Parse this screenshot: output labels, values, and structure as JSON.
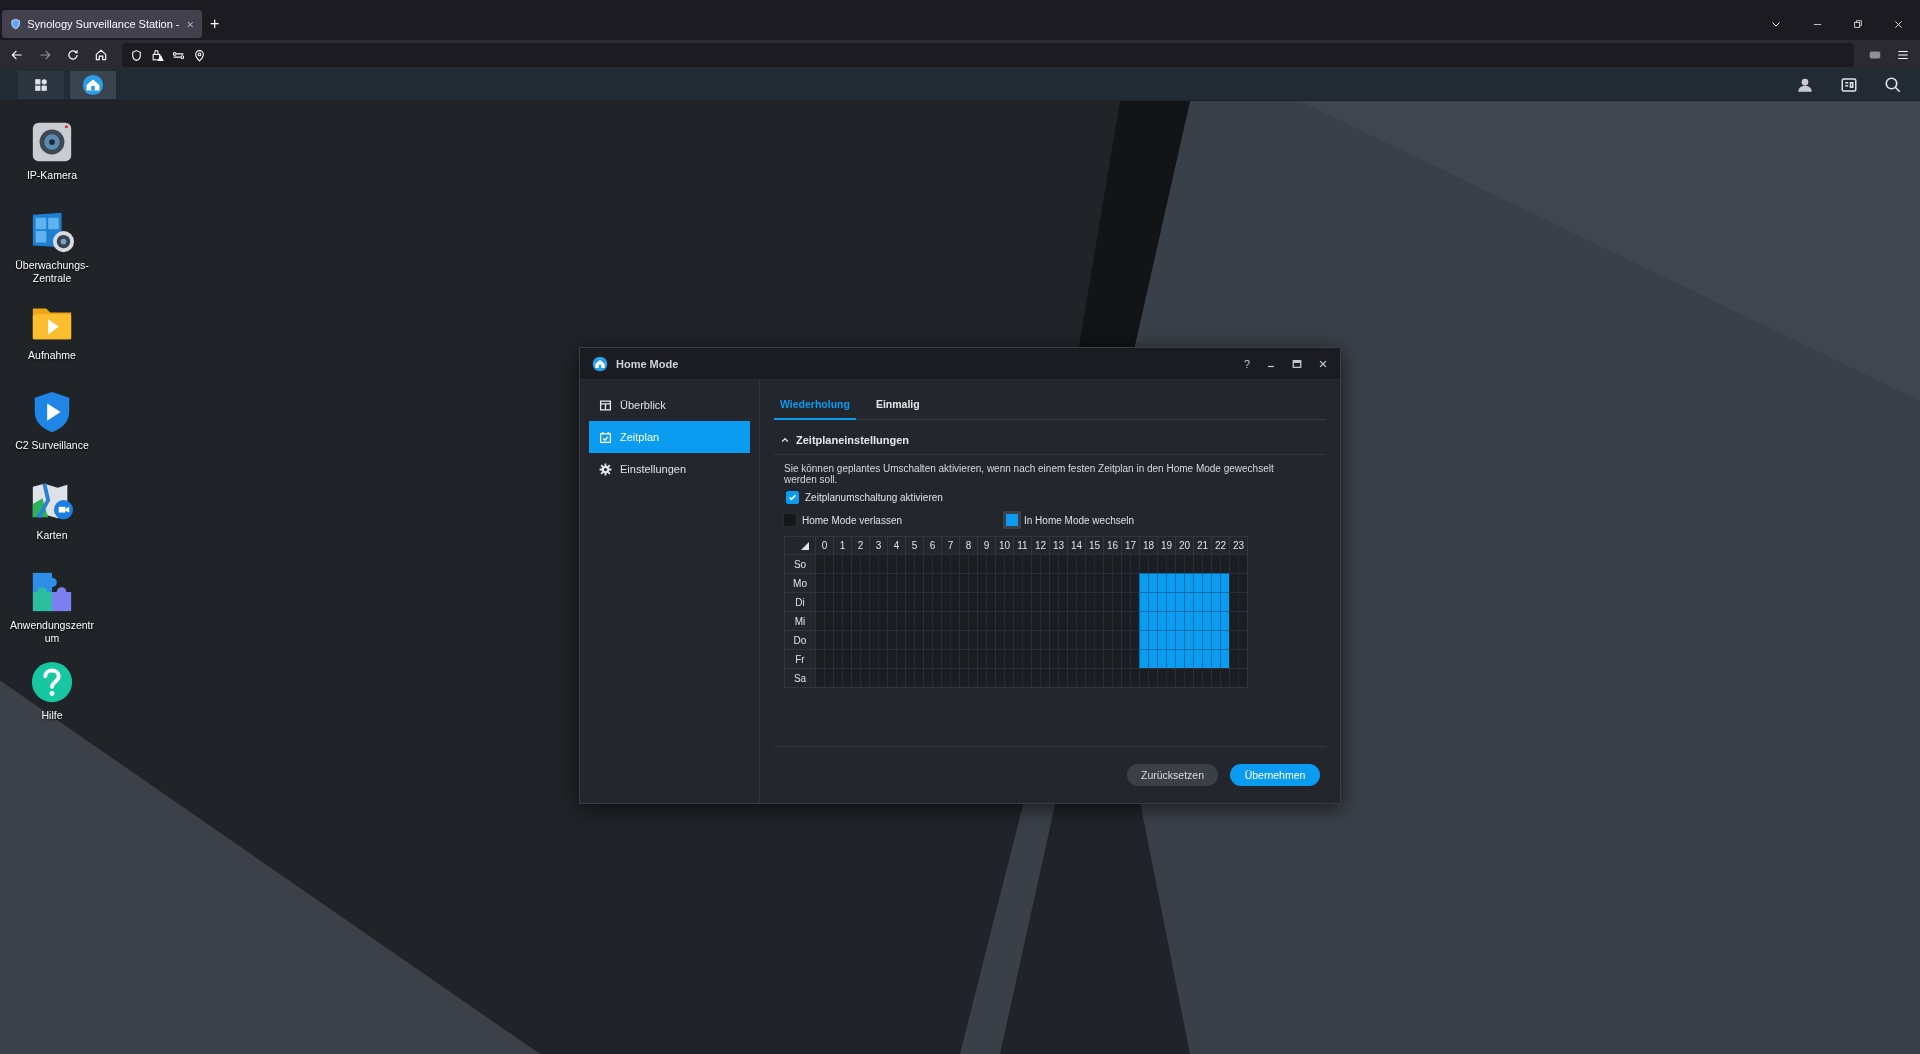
{
  "browser": {
    "tab": {
      "title": "Synology Surveillance Station -"
    },
    "new_tab": "+"
  },
  "desktop_icons": [
    {
      "label": "IP-Kamera",
      "kind": "camera"
    },
    {
      "label": "Überwachungs-Zentrale",
      "kind": "monitor"
    },
    {
      "label": "Aufnahme",
      "kind": "recording"
    },
    {
      "label": "C2 Surveillance",
      "kind": "shield"
    },
    {
      "label": "Karten",
      "kind": "map"
    },
    {
      "label": "Anwendungszentrum",
      "kind": "puzzle"
    },
    {
      "label": "Hilfe",
      "kind": "help"
    }
  ],
  "dialog": {
    "title": "Home Mode",
    "help": "?",
    "sidebar": [
      {
        "label": "Überblick",
        "kind": "overview",
        "selected": false
      },
      {
        "label": "Zeitplan",
        "kind": "calendar",
        "selected": true
      },
      {
        "label": "Einstellungen",
        "kind": "gear",
        "selected": false
      }
    ],
    "tabs": [
      {
        "label": "Wiederholung",
        "selected": true
      },
      {
        "label": "Einmalig",
        "selected": false
      }
    ],
    "section": {
      "title": "Zeitplaneinstellungen",
      "expanded": true
    },
    "description": "Sie können geplantes Umschalten aktivieren, wenn nach einem festen Zeitplan in den Home Mode gewechselt werden soll.",
    "enable_checkbox": {
      "label": "Zeitplanumschaltung aktivieren",
      "checked": true
    },
    "legend": [
      {
        "label": "Home Mode verlassen",
        "kind": "leave",
        "selected": false
      },
      {
        "label": "In Home Mode wechseln",
        "kind": "enter",
        "selected": true
      }
    ],
    "schedule": {
      "hours": [
        "0",
        "1",
        "2",
        "3",
        "4",
        "5",
        "6",
        "7",
        "8",
        "9",
        "10",
        "11",
        "12",
        "13",
        "14",
        "15",
        "16",
        "17",
        "18",
        "19",
        "20",
        "21",
        "22",
        "23"
      ],
      "rows": [
        {
          "day": "So",
          "hours": [
            false,
            false,
            false,
            false,
            false,
            false,
            false,
            false,
            false,
            false,
            false,
            false,
            false,
            false,
            false,
            false,
            false,
            false,
            false,
            false,
            false,
            false,
            false,
            false
          ]
        },
        {
          "day": "Mo",
          "hours": [
            false,
            false,
            false,
            false,
            false,
            false,
            false,
            false,
            false,
            false,
            false,
            false,
            false,
            false,
            false,
            false,
            false,
            false,
            true,
            true,
            true,
            true,
            true,
            false
          ]
        },
        {
          "day": "Di",
          "hours": [
            false,
            false,
            false,
            false,
            false,
            false,
            false,
            false,
            false,
            false,
            false,
            false,
            false,
            false,
            false,
            false,
            false,
            false,
            true,
            true,
            true,
            true,
            true,
            false
          ]
        },
        {
          "day": "Mi",
          "hours": [
            false,
            false,
            false,
            false,
            false,
            false,
            false,
            false,
            false,
            false,
            false,
            false,
            false,
            false,
            false,
            false,
            false,
            false,
            true,
            true,
            true,
            true,
            true,
            false
          ]
        },
        {
          "day": "Do",
          "hours": [
            false,
            false,
            false,
            false,
            false,
            false,
            false,
            false,
            false,
            false,
            false,
            false,
            false,
            false,
            false,
            false,
            false,
            false,
            true,
            true,
            true,
            true,
            true,
            false
          ]
        },
        {
          "day": "Fr",
          "hours": [
            false,
            false,
            false,
            false,
            false,
            false,
            false,
            false,
            false,
            false,
            false,
            false,
            false,
            false,
            false,
            false,
            false,
            false,
            true,
            true,
            true,
            true,
            true,
            false
          ]
        },
        {
          "day": "Sa",
          "hours": [
            false,
            false,
            false,
            false,
            false,
            false,
            false,
            false,
            false,
            false,
            false,
            false,
            false,
            false,
            false,
            false,
            false,
            false,
            false,
            false,
            false,
            false,
            false,
            false
          ]
        }
      ]
    },
    "buttons": [
      {
        "label": "Zurücksetzen",
        "kind": "secondary"
      },
      {
        "label": "Übernehmen",
        "kind": "primary"
      }
    ]
  }
}
